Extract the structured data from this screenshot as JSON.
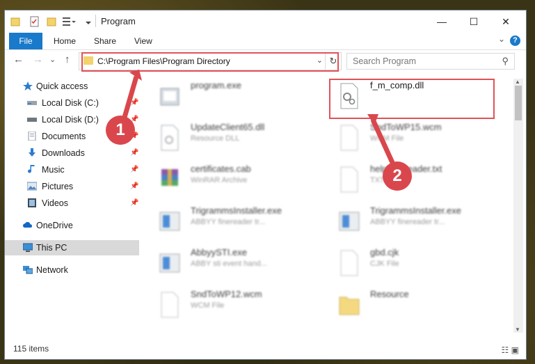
{
  "window": {
    "title": "Program"
  },
  "ribbon": {
    "tabs": [
      "File",
      "Home",
      "Share",
      "View"
    ],
    "help": "?",
    "collapse": "⌄"
  },
  "window_controls": {
    "minimize": "—",
    "maximize": "☐",
    "close": "✕"
  },
  "nav": {
    "back": "←",
    "forward": "→",
    "recent": "⌄",
    "up": "↑"
  },
  "address": {
    "path": "C:\\Program Files\\Program Directory",
    "dropdown": "⌄",
    "refresh": "↻"
  },
  "search": {
    "placeholder": "Search Program",
    "icon": "⚲"
  },
  "sidebar": {
    "items": [
      {
        "label": "Quick access",
        "icon": "star-icon",
        "pinned": false
      },
      {
        "label": "Local Disk (C:)",
        "icon": "drive-icon",
        "pinned": true
      },
      {
        "label": "Local Disk (D:)",
        "icon": "drive-icon",
        "pinned": true
      },
      {
        "label": "Documents",
        "icon": "documents-icon",
        "pinned": true
      },
      {
        "label": "Downloads",
        "icon": "downloads-icon",
        "pinned": true
      },
      {
        "label": "Music",
        "icon": "music-icon",
        "pinned": true
      },
      {
        "label": "Pictures",
        "icon": "pictures-icon",
        "pinned": true
      },
      {
        "label": "Videos",
        "icon": "videos-icon",
        "pinned": true
      },
      {
        "label": "OneDrive",
        "icon": "onedrive-icon",
        "pinned": false
      },
      {
        "label": "This PC",
        "icon": "pc-icon",
        "pinned": false,
        "selected": true
      },
      {
        "label": "Network",
        "icon": "network-icon",
        "pinned": false
      }
    ],
    "pin_glyph": "📌"
  },
  "files": [
    {
      "name": "program.exe",
      "type": "",
      "icon": "exe-icon"
    },
    {
      "name": "f_m_comp.dll",
      "type": "",
      "icon": "dll-gear-icon"
    },
    {
      "name": "UpdateClient65.dll",
      "type": "Resource DLL",
      "icon": "dll-icon"
    },
    {
      "name": "SndToWP15.wcm",
      "type": "WCM File",
      "icon": "blank-file-icon"
    },
    {
      "name": "certificates.cab",
      "type": "WinRAR Archive",
      "icon": "archive-icon"
    },
    {
      "name": "help.finereader.txt",
      "type": "TXT File",
      "icon": "blank-file-icon"
    },
    {
      "name": "TrigrammsInstaller.exe",
      "type": "ABBYY finereader tr...",
      "icon": "installer-icon"
    },
    {
      "name": "TrigrammsInstaller.exe",
      "type": "ABBYY finereader tr...",
      "icon": "installer-icon"
    },
    {
      "name": "AbbyySTI.exe",
      "type": "ABBY sti event hand...",
      "icon": "installer-icon"
    },
    {
      "name": "gbd.cjk",
      "type": "CJK File",
      "icon": "blank-file-icon"
    },
    {
      "name": "SndToWP12.wcm",
      "type": "WCM File",
      "icon": "blank-file-icon"
    },
    {
      "name": "Resource",
      "type": "",
      "icon": "folder-icon"
    }
  ],
  "status": {
    "count": "115 items"
  },
  "callouts": [
    "1",
    "2"
  ],
  "colors": {
    "accent": "#1979ca",
    "highlight": "#e05258",
    "callout": "#d9474d"
  }
}
